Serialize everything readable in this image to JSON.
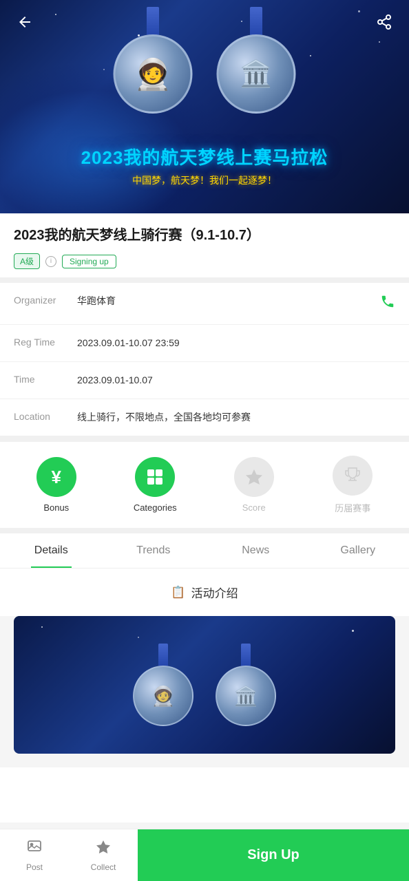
{
  "header": {
    "back_label": "←",
    "share_label": "share"
  },
  "hero": {
    "title": "2023我的航天梦线上赛马拉松",
    "subtitle": "中国梦，航天梦！我们一起逐梦！",
    "medal1_icon": "🧑‍🚀",
    "medal2_icon": "🏛️"
  },
  "event": {
    "title": "2023我的航天梦线上骑行赛（9.1-10.7）",
    "level_badge": "A级",
    "status_badge": "Signing up",
    "organizer_label": "Organizer",
    "organizer_value": "华跑体育",
    "reg_time_label": "Reg Time",
    "reg_time_value": "2023.09.01-10.07 23:59",
    "time_label": "Time",
    "time_value": "2023.09.01-10.07",
    "location_label": "Location",
    "location_value": "线上骑行，不限地点，全国各地均可参赛"
  },
  "icons": [
    {
      "id": "bonus",
      "label": "Bonus",
      "icon": "¥",
      "style": "green"
    },
    {
      "id": "categories",
      "label": "Categories",
      "icon": "⊞",
      "style": "green"
    },
    {
      "id": "score",
      "label": "Score",
      "icon": "★",
      "style": "gray"
    },
    {
      "id": "history",
      "label": "历届赛事",
      "icon": "🏆",
      "style": "gray"
    }
  ],
  "tabs": [
    {
      "id": "details",
      "label": "Details",
      "active": true
    },
    {
      "id": "trends",
      "label": "Trends",
      "active": false
    },
    {
      "id": "news",
      "label": "News",
      "active": false
    },
    {
      "id": "gallery",
      "label": "Gallery",
      "active": false
    }
  ],
  "section_title": "📋 活动介绍",
  "bottom_bar": {
    "post_label": "Post",
    "post_icon": "📷",
    "collect_label": "Collect",
    "collect_icon": "★",
    "signup_label": "Sign Up"
  }
}
